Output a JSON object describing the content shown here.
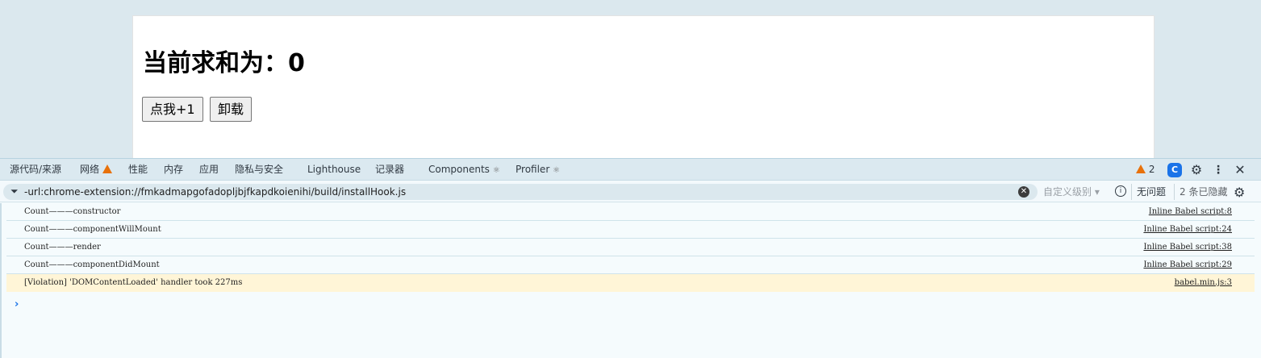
{
  "page": {
    "heading": "当前求和为：0",
    "buttons": {
      "increment": "点我+1",
      "unmount": "卸载"
    }
  },
  "devtools": {
    "tabs": [
      {
        "label": "源代码/来源"
      },
      {
        "label": "网络"
      },
      {
        "label": "性能"
      },
      {
        "label": "内存"
      },
      {
        "label": "应用"
      },
      {
        "label": "隐私与安全"
      },
      {
        "label": "Lighthouse"
      },
      {
        "label": "记录器"
      },
      {
        "label": "Components"
      },
      {
        "label": "Profiler"
      }
    ],
    "react_marker": "⚛",
    "warning_count": "2",
    "filter": {
      "value": "-url:chrome-extension://fmkadmapgofadopljbjfkapdkoienihi/build/installHook.js",
      "levels": "自定义级别 ▾",
      "no_issues": "无问题",
      "hidden": "2 条已隐藏"
    },
    "console_rows": [
      {
        "message": "Count———constructor",
        "source": "Inline Babel script:8",
        "level": "log"
      },
      {
        "message": "Count———componentWillMount",
        "source": "Inline Babel script:24",
        "level": "log"
      },
      {
        "message": "Count———render",
        "source": "Inline Babel script:38",
        "level": "log"
      },
      {
        "message": "Count———componentDidMount",
        "source": "Inline Babel script:29",
        "level": "log"
      },
      {
        "message": "[Violation] 'DOMContentLoaded' handler took 227ms",
        "source": "babel.min.js:3",
        "level": "warning"
      }
    ],
    "prompt_symbol": "›"
  },
  "colors": {
    "warning": "#e8710a",
    "accent": "#1a73e8",
    "warning_row_bg": "#fff5d7"
  }
}
